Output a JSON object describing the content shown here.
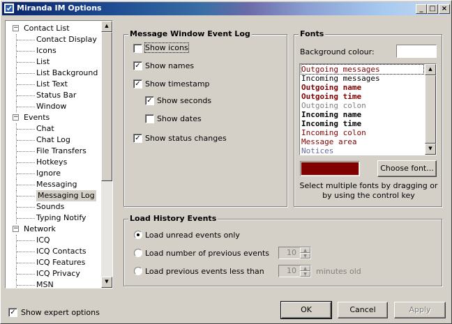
{
  "window": {
    "title": "Miranda IM Options",
    "buttons": {
      "minimize": "_",
      "maximize": "□",
      "close": "×"
    }
  },
  "tree": {
    "items": [
      {
        "label": "Contact List",
        "level": 0,
        "expander": "−"
      },
      {
        "label": "Contact Display",
        "level": 1
      },
      {
        "label": "Icons",
        "level": 1
      },
      {
        "label": "List",
        "level": 1
      },
      {
        "label": "List Background",
        "level": 1
      },
      {
        "label": "List Text",
        "level": 1
      },
      {
        "label": "Status Bar",
        "level": 1
      },
      {
        "label": "Window",
        "level": 1
      },
      {
        "label": "Events",
        "level": 0,
        "expander": "−"
      },
      {
        "label": "Chat",
        "level": 1
      },
      {
        "label": "Chat Log",
        "level": 1
      },
      {
        "label": "File Transfers",
        "level": 1
      },
      {
        "label": "Hotkeys",
        "level": 1
      },
      {
        "label": "Ignore",
        "level": 1
      },
      {
        "label": "Messaging",
        "level": 1
      },
      {
        "label": "Messaging Log",
        "level": 1,
        "selected": true
      },
      {
        "label": "Sounds",
        "level": 1
      },
      {
        "label": "Typing Notify",
        "level": 1
      },
      {
        "label": "Network",
        "level": 0,
        "expander": "−"
      },
      {
        "label": "ICQ",
        "level": 1
      },
      {
        "label": "ICQ Contacts",
        "level": 1
      },
      {
        "label": "ICQ Features",
        "level": 1
      },
      {
        "label": "ICQ Privacy",
        "level": 1
      },
      {
        "label": "MSN",
        "level": 1
      }
    ]
  },
  "event_log": {
    "title": "Message Window Event Log",
    "show_icons": {
      "label": "Show icons",
      "checked": false
    },
    "show_names": {
      "label": "Show names",
      "checked": true
    },
    "show_timestamp": {
      "label": "Show timestamp",
      "checked": true
    },
    "show_seconds": {
      "label": "Show seconds",
      "checked": true
    },
    "show_dates": {
      "label": "Show dates",
      "checked": false
    },
    "show_status": {
      "label": "Show status changes",
      "checked": true
    }
  },
  "fonts": {
    "title": "Fonts",
    "background_label": "Background colour:",
    "items": [
      {
        "label": "Outgoing messages",
        "color": "#800000",
        "bold": false
      },
      {
        "label": "Incoming messages",
        "color": "#000000",
        "bold": false
      },
      {
        "label": "Outgoing name",
        "color": "#800000",
        "bold": true
      },
      {
        "label": "Outgoing time",
        "color": "#800000",
        "bold": true
      },
      {
        "label": "Outgoing colon",
        "color": "#808080",
        "bold": false
      },
      {
        "label": "Incoming name",
        "color": "#000000",
        "bold": true
      },
      {
        "label": "Incoming time",
        "color": "#000000",
        "bold": true
      },
      {
        "label": "Incoming colon",
        "color": "#800000",
        "bold": false
      },
      {
        "label": "Message area",
        "color": "#800000",
        "bold": false
      },
      {
        "label": "Notices",
        "color": "#6a6aa0",
        "bold": false
      }
    ],
    "swatch_color": "#800000",
    "choose_font": "Choose font...",
    "hint": "Select multiple fonts by dragging or by using the control key"
  },
  "history": {
    "title": "Load History Events",
    "unread": {
      "label": "Load unread events only",
      "selected": true
    },
    "number": {
      "label": "Load number of previous events",
      "value": "10"
    },
    "time": {
      "label": "Load previous events less than",
      "value": "10",
      "suffix": "minutes old"
    }
  },
  "footer": {
    "expert": {
      "label": "Show expert options",
      "checked": true
    },
    "ok": "OK",
    "cancel": "Cancel",
    "apply": "Apply"
  }
}
